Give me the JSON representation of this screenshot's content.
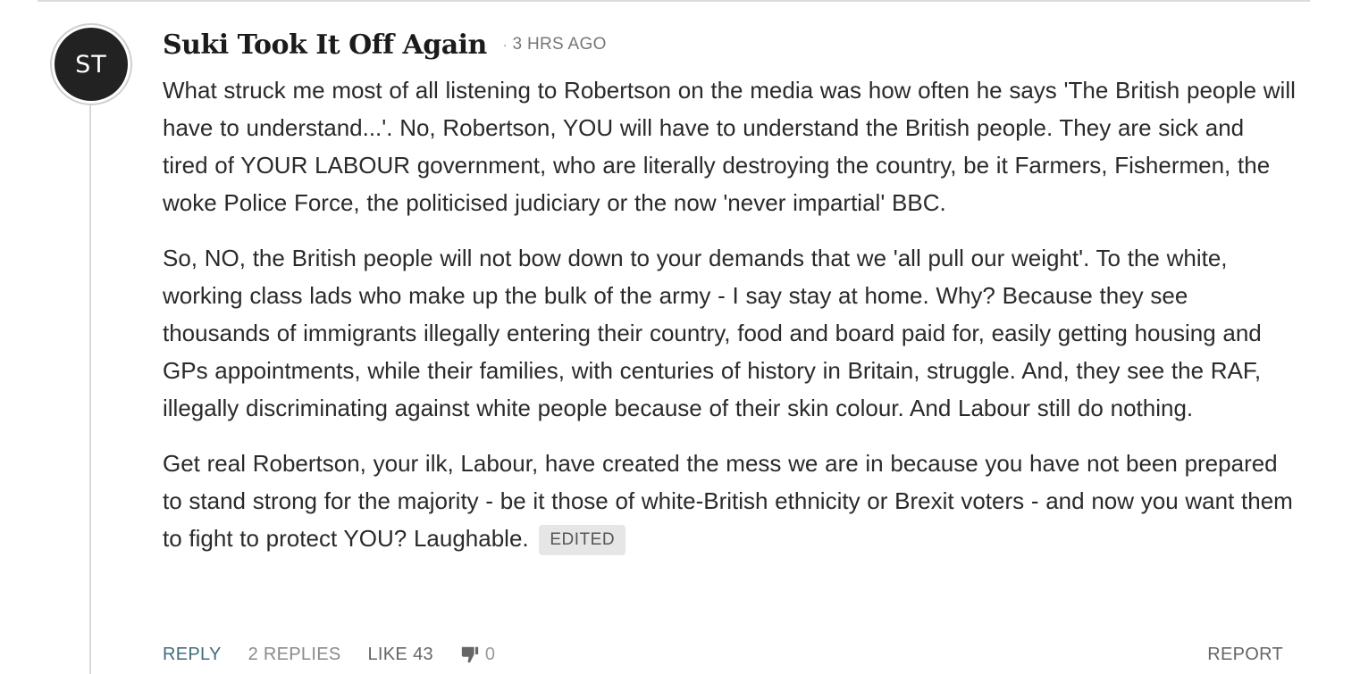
{
  "comment": {
    "avatar_initials": "ST",
    "author": "Suki Took It Off Again",
    "separator": "·",
    "timestamp": "3 HRS AGO",
    "paragraphs": [
      "What struck me most of all listening to Robertson on the media was how often he says 'The British people will have to understand...'. No, Robertson, YOU will have to understand the British people. They are sick and tired of YOUR LABOUR government, who are literally destroying the country, be it Farmers, Fishermen, the woke Police Force, the politicised judiciary or the now 'never impartial' BBC.",
      "So, NO, the British people will not bow down to your demands that we 'all pull our weight'. To the white, working class lads who make up the bulk of the army - I say stay at home. Why? Because they see thousands of immigrants illegally entering their country, food and board paid for, easily getting housing and GPs appointments, while their families, with centuries of history in Britain, struggle. And, they see the RAF, illegally discriminating against white people because of their skin colour. And Labour still do nothing.",
      "Get real Robertson, your ilk, Labour, have created the mess we are in because you have not been prepared to stand strong for the majority - be it those of white-British ethnicity or Brexit voters - and now you want them to fight to protect YOU? Laughable."
    ],
    "edited_badge": "EDITED"
  },
  "actions": {
    "reply": "REPLY",
    "replies_count": "2",
    "replies_label": "REPLIES",
    "like_label": "LIKE",
    "like_count": "43",
    "dislike_icon": "thumb-down-icon",
    "dislike_count": "0",
    "report": "REPORT"
  },
  "colors": {
    "reply_accent": "#3f6c7a",
    "avatar_bg": "#222222",
    "badge_bg": "#e6e6e6"
  }
}
